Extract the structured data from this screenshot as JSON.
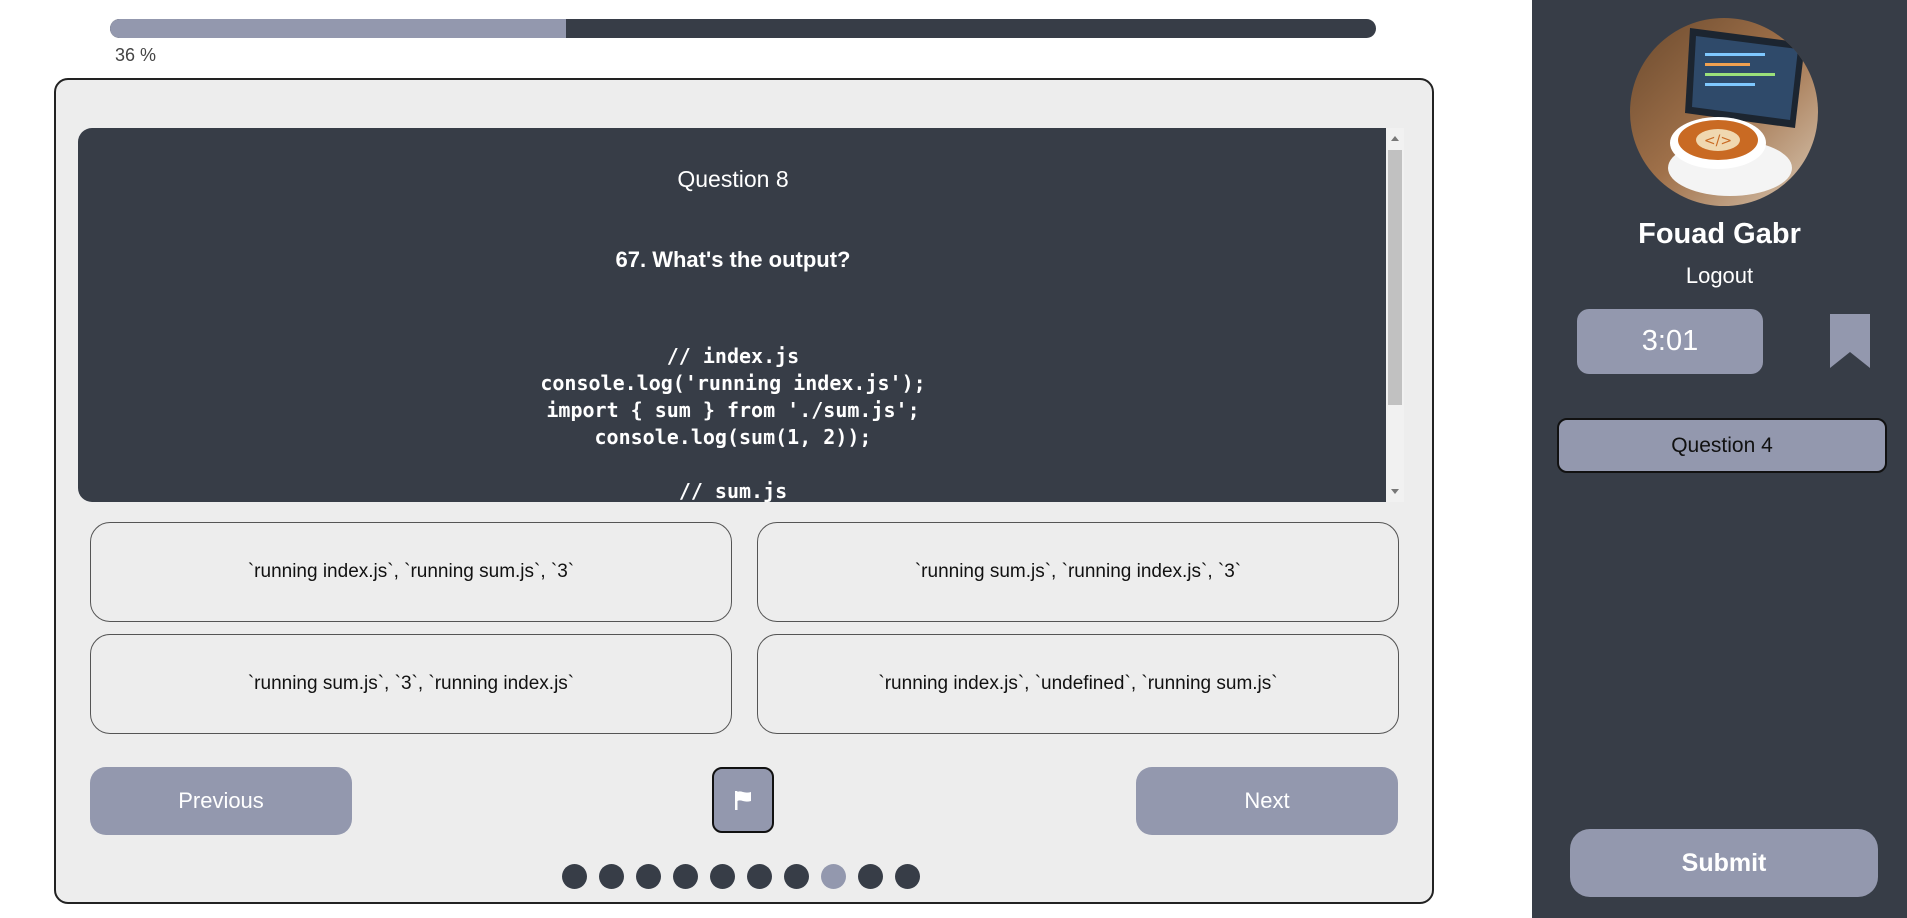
{
  "progress": {
    "label": "36 %",
    "fraction": 0.36
  },
  "question": {
    "number": "Question 8",
    "title": "67. What's the output?",
    "code": "// index.js\nconsole.log('running index.js');\nimport { sum } from './sum.js';\nconsole.log(sum(1, 2));\n\n// sum.js"
  },
  "answers": [
    "`running index.js`, `running sum.js`, `3`",
    "`running sum.js`, `running index.js`, `3`",
    "`running sum.js`, `3`, `running index.js`",
    "`running index.js`, `undefined`, `running sum.js`"
  ],
  "nav": {
    "previous_label": "Previous",
    "next_label": "Next",
    "flag_icon": "flag-icon"
  },
  "pagination": {
    "total": 10,
    "active_index": 7
  },
  "sidebar": {
    "user_name": "Fouad Gabr",
    "logout_label": "Logout",
    "timer": "3:01",
    "bookmark_icon": "bookmark-icon",
    "saved_questions": [
      "Question 4"
    ],
    "submit_label": "Submit"
  },
  "colors": {
    "dark": "#373d47",
    "accent": "#9398ae",
    "card_bg": "#ededed"
  }
}
